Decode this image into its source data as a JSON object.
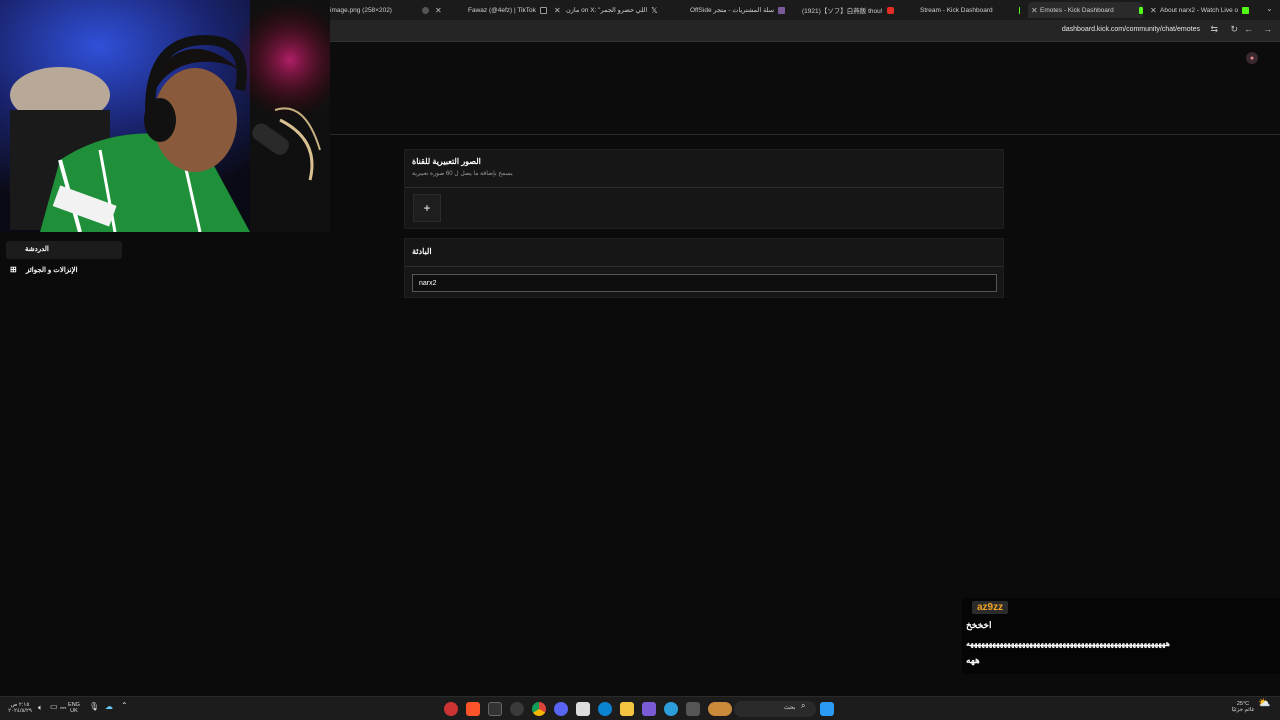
{
  "browser": {
    "tabs": [
      {
        "title": "image.png (258×202)",
        "active": false
      },
      {
        "title": "Fawaz (@4efz) | TikTok",
        "active": false
      },
      {
        "title": "مازن on X: \"اللي حضرو الجمر",
        "active": false
      },
      {
        "title": "OffSide سلة المشتريات - متجر",
        "active": false
      },
      {
        "title": "(1921)【ソフ】白燕飯 thou!",
        "active": false
      },
      {
        "title": "Stream - Kick Dashboard",
        "active": false
      },
      {
        "title": "Emotes - Kick Dashboard",
        "active": true
      },
      {
        "title": "About narx2 - Watch Live o",
        "active": false
      }
    ],
    "url": "dashboard.kick.com/community/chat/emotes"
  },
  "sidebar": {
    "items": [
      {
        "label": "الدردشة",
        "icon": "chat-icon"
      },
      {
        "label": "الإنزالات و الجوائز",
        "icon": "gift-icon"
      }
    ]
  },
  "emotes_card": {
    "title": "الصور التعبيرية للقناة",
    "subtitle": "يسمح بإضافة ما يصل ل 60 صورة تعبيرية",
    "add_label": "+"
  },
  "prefix_card": {
    "title": "البادئة",
    "value": "narx2"
  },
  "chat_overlay": {
    "username": "az9zz",
    "lines": [
      "اخخخخ",
      "ههههههههههههههههههههههههههههههههههههههههههههههههههههههه",
      "ههه"
    ]
  },
  "taskbar": {
    "time": "٢:١٥ ص",
    "date": "٢٠٢٤/٨/٢٩",
    "lang_top": "ENG",
    "lang_bottom": "UK",
    "search_placeholder": "بحث",
    "weather_temp": "25°C",
    "weather_desc": "غائم جزئيًا"
  },
  "colors": {
    "kick_green": "#53fc18",
    "chat_username": "#f5a623",
    "page_bg": "#0b0b0b",
    "card_bg": "#161616"
  }
}
